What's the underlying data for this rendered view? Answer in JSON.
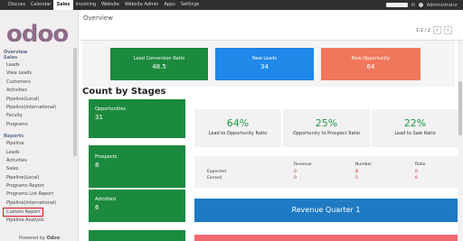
{
  "topbar": {
    "menu": [
      "Discuss",
      "Calendar",
      "Sales",
      "Invoicing",
      "Website",
      "Website Admin",
      "Apps",
      "Settings"
    ],
    "active_index": 2,
    "user": "Administrator"
  },
  "sidebar": {
    "logo": "odoo",
    "sections": [
      {
        "title": "Overview",
        "items": []
      },
      {
        "title": "Sales",
        "items": [
          "Leads",
          "View Leads",
          "Customers",
          "Activities",
          "Pipeline(Local)",
          "Pipeline(international)",
          "Faculty",
          "Programs"
        ]
      },
      {
        "title": "Reports",
        "items": [
          "Pipeline",
          "Leads",
          "Activities",
          "Sales",
          "Pipeline(Local)",
          "Programs Report",
          "Programs List Report",
          "Pipeline(international)",
          "Custom Report",
          "Pipeline Analysis"
        ]
      }
    ],
    "highlighted_item": "Custom Report",
    "powered_prefix": "Powered by",
    "powered_brand": "Odoo"
  },
  "main": {
    "title": "Overview",
    "pager": "1-2 / 2",
    "kpis": [
      {
        "label": "Lead Conversion Ratio",
        "value": "48.5",
        "color": "#1c8a3e"
      },
      {
        "label": "New Leads",
        "value": "34",
        "color": "#1f88e8"
      },
      {
        "label": "New Opportunity",
        "value": "64",
        "color": "#f0775b"
      }
    ],
    "section_title": "Count by Stages",
    "stages": [
      {
        "label": "Opportunities",
        "value": "31"
      },
      {
        "label": "Prospects",
        "value": "8"
      },
      {
        "label": "Admitted",
        "value": "6"
      },
      {
        "label": "Enrolled",
        "value": ""
      }
    ],
    "ratios": [
      {
        "pct": "64%",
        "label": "Lead to Opportunity Ratio"
      },
      {
        "pct": "25%",
        "label": "Opportunity to Prospect Ratio"
      },
      {
        "pct": "22%",
        "label": "Lead to Sale Ratio"
      }
    ],
    "revenue_table": {
      "headers": [
        "Revenue",
        "Number",
        "Ratio"
      ],
      "rows": [
        {
          "label": "Expected",
          "values": [
            "0",
            "8",
            "0"
          ]
        },
        {
          "label": "Earned",
          "values": [
            "0",
            "5",
            "0"
          ]
        }
      ]
    },
    "revenue_banner": "Revenue Quarter 1"
  }
}
